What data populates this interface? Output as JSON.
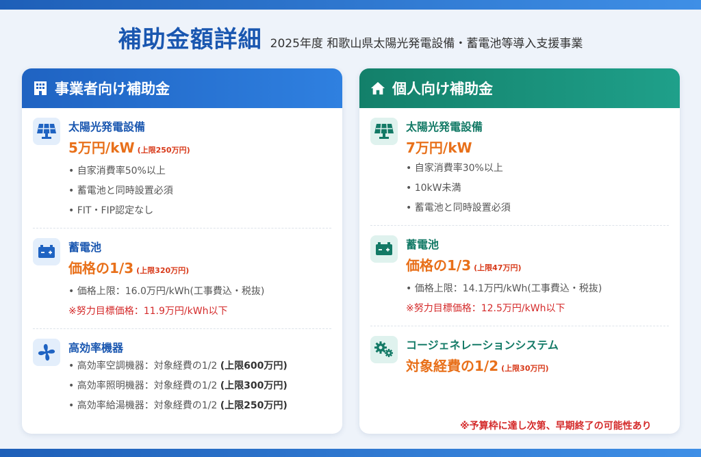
{
  "header": {
    "title": "補助金額詳細",
    "subtitle": "2025年度 和歌山県太陽光発電設備・蓄電池等導入支援事業"
  },
  "business": {
    "title": "事業者向け補助金",
    "icon": "building-icon",
    "solar": {
      "name": "太陽光発電設備",
      "amount": "5万円/kW",
      "limit": "(上限250万円)",
      "bullets": [
        "• 自家消費率50%以上",
        "• 蓄電池と同時設置必須",
        "• FIT・FIP認定なし"
      ]
    },
    "battery": {
      "name": "蓄電池",
      "amount": "価格の1/3",
      "limit": "(上限320万円)",
      "bullet": "• 価格上限：16.0万円/kWh(工事費込・税抜)",
      "warn": "※努力目標価格：11.9万円/kWh以下"
    },
    "efficiency": {
      "name": "高効率機器",
      "items": [
        {
          "text": "• 高効率空調機器：対象経費の1/2 ",
          "limit": "(上限600万円)"
        },
        {
          "text": "• 高効率照明機器：対象経費の1/2 ",
          "limit": "(上限300万円)"
        },
        {
          "text": "• 高効率給湯機器：対象経費の1/2 ",
          "limit": "(上限250万円)"
        }
      ]
    }
  },
  "individual": {
    "title": "個人向け補助金",
    "icon": "home-icon",
    "solar": {
      "name": "太陽光発電設備",
      "amount": "7万円/kW",
      "bullets": [
        "• 自家消費率30%以上",
        "• 10kW未満",
        "• 蓄電池と同時設置必須"
      ]
    },
    "battery": {
      "name": "蓄電池",
      "amount": "価格の1/3",
      "limit": "(上限47万円)",
      "bullet": "• 価格上限：14.1万円/kWh(工事費込・税抜)",
      "warn": "※努力目標価格：12.5万円/kWh以下"
    },
    "cogen": {
      "name": "コージェネレーションシステム",
      "amount": "対象経費の1/2",
      "limit": "(上限30万円)"
    }
  },
  "note": "※予算枠に達し次第、早期終了の可能性あり",
  "colors": {
    "business_accent": "#1f63c2",
    "individual_accent": "#13806a",
    "amount": "#e8701a",
    "warning": "#d42a2a"
  }
}
